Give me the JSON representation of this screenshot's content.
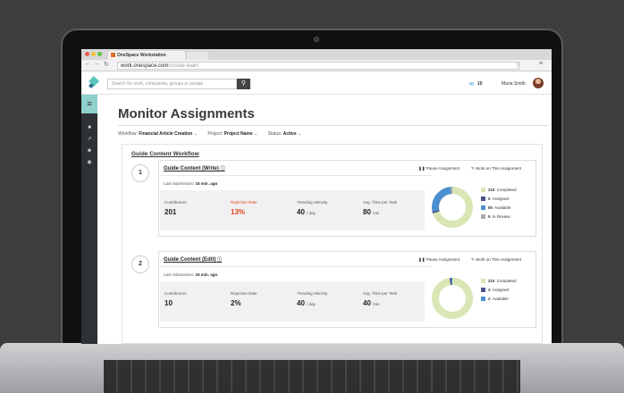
{
  "browser": {
    "tab_title": "OneSpace Workstation",
    "url_host": "work.onespace.com",
    "url_path": "/create-team"
  },
  "header": {
    "search_placeholder": "Search for work, companies, groups or people",
    "message_count": "10",
    "user_name": "Maria Smith"
  },
  "page": {
    "title": "Monitor Assignments",
    "filters": [
      {
        "label": "Workflow:",
        "value": "Financial Article Creation"
      },
      {
        "label": "Project:",
        "value": "Project Name"
      },
      {
        "label": "Status:",
        "value": "Active"
      }
    ]
  },
  "workflow": {
    "title": "Guide Content Workflow",
    "steps": [
      {
        "number": "1",
        "title": "Guide Content (Write)",
        "pause_label": "Pause Assignment",
        "work_label": "Work on This Assignment",
        "last_submission_label": "Last Submission:",
        "last_submission_value": "15 min. ago",
        "stats": [
          {
            "label": "Contributors",
            "value": "201",
            "unit": "",
            "color": "#222222",
            "label_color": "#555555"
          },
          {
            "label": "Rejection Rate",
            "value": "13%",
            "unit": "",
            "color": "#e0461e",
            "label_color": "#e0461e"
          },
          {
            "label": "Trending Velocity",
            "value": "40",
            "unit": "/ day",
            "color": "#222222",
            "label_color": "#555555"
          },
          {
            "label": "Avg. Time per Task",
            "value": "80",
            "unit": "min",
            "color": "#222222",
            "label_color": "#555555"
          }
        ],
        "legend": [
          {
            "count": "210",
            "label": "Completed",
            "color": "#d9e6b5",
            "value": 210
          },
          {
            "count": "5",
            "label": "Assigned",
            "color": "#4b4f8f",
            "value": 5
          },
          {
            "count": "80",
            "label": "Available",
            "color": "#4a90d0",
            "value": 80
          },
          {
            "count": "5",
            "label": "In Review",
            "color": "#aaaaaa",
            "value": 5
          }
        ]
      },
      {
        "number": "2",
        "title": "Guide Content (Edit)",
        "pause_label": "Pause Assignment",
        "work_label": "Work on This Assignment",
        "last_submission_label": "Last Submission:",
        "last_submission_value": "15 min. ago",
        "stats": [
          {
            "label": "Contributors",
            "value": "10",
            "unit": "",
            "color": "#222222",
            "label_color": "#555555"
          },
          {
            "label": "Rejection Rate",
            "value": "2%",
            "unit": "",
            "color": "#222222",
            "label_color": "#555555"
          },
          {
            "label": "Trending Velocity",
            "value": "40",
            "unit": "/ day",
            "color": "#222222",
            "label_color": "#555555"
          },
          {
            "label": "Avg. Time per Task",
            "value": "40",
            "unit": "min",
            "color": "#222222",
            "label_color": "#555555"
          }
        ],
        "legend": [
          {
            "count": "210",
            "label": "Completed",
            "color": "#d9e6b5",
            "value": 210
          },
          {
            "count": "3",
            "label": "Assigned",
            "color": "#4b4f8f",
            "value": 3
          },
          {
            "count": "2",
            "label": "Available",
            "color": "#4a90d0",
            "value": 2
          }
        ]
      }
    ]
  },
  "colors": {
    "sidebar": "#2e3236",
    "sidebar_active": "#8fd0cc",
    "alert": "#e0461e",
    "accent": "#2b9ad6"
  }
}
